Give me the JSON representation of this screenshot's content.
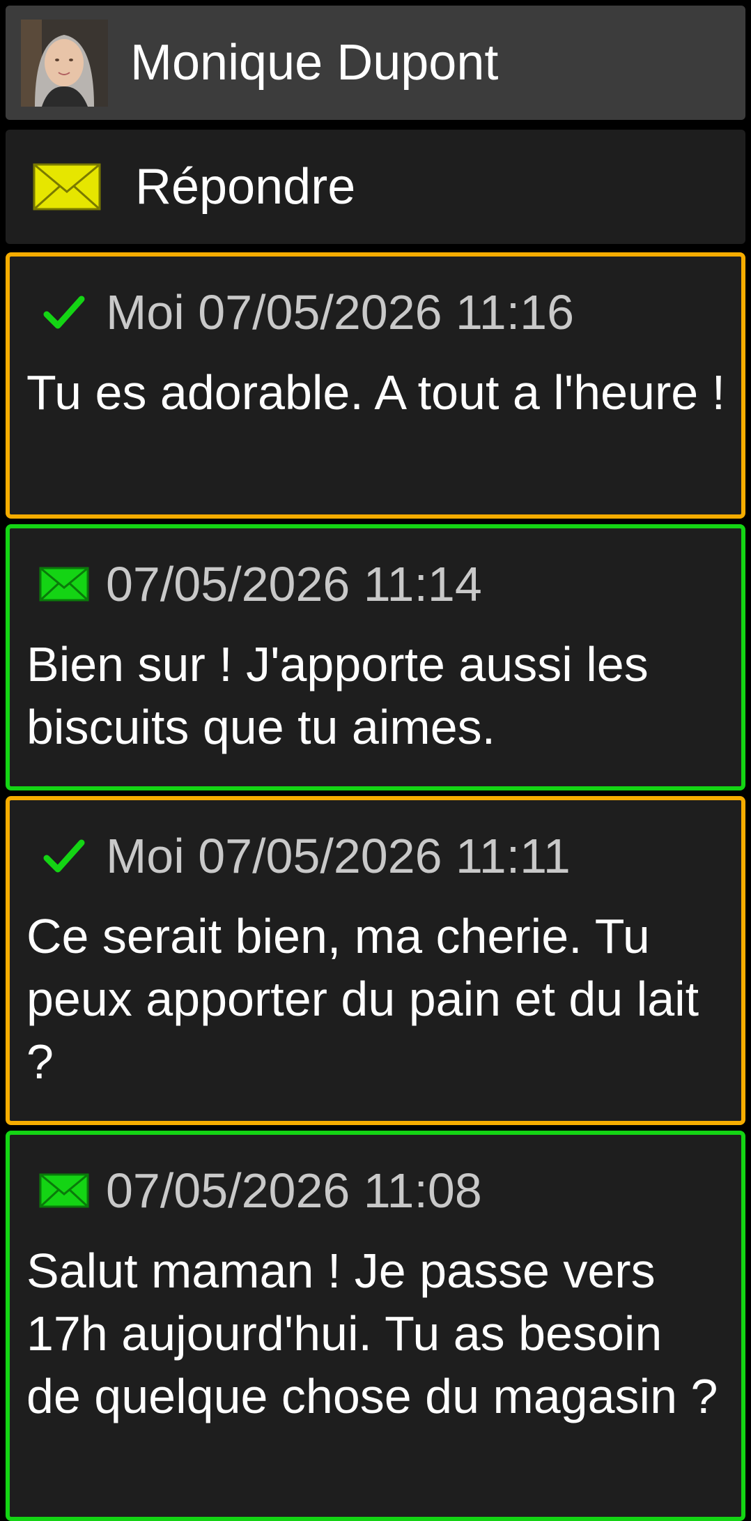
{
  "header": {
    "contact_name": "Monique Dupont",
    "avatar": "profile-photo"
  },
  "reply": {
    "label": "Répondre",
    "icon": "envelope-icon",
    "icon_color": "#e6e600"
  },
  "colors": {
    "sent_border": "#f5ac00",
    "received_border": "#14d414",
    "check": "#14d414",
    "received_icon": "#14d414"
  },
  "messages": [
    {
      "direction": "sent",
      "status_icon": "check-icon",
      "meta": "Moi 07/05/2026 11:16",
      "text": "Tu es adorable. A tout a l'heure !"
    },
    {
      "direction": "received",
      "status_icon": "envelope-icon",
      "meta": "07/05/2026 11:14",
      "text": "Bien sur ! J'apporte aussi les biscuits que tu aimes."
    },
    {
      "direction": "sent",
      "status_icon": "check-icon",
      "meta": "Moi 07/05/2026 11:11",
      "text": "Ce serait bien, ma cherie. Tu peux apporter du pain et du lait ?"
    },
    {
      "direction": "received",
      "status_icon": "envelope-icon",
      "meta": "07/05/2026 11:08",
      "text": "Salut maman ! Je passe vers 17h aujourd'hui. Tu as besoin de quelque chose du magasin ?"
    }
  ]
}
